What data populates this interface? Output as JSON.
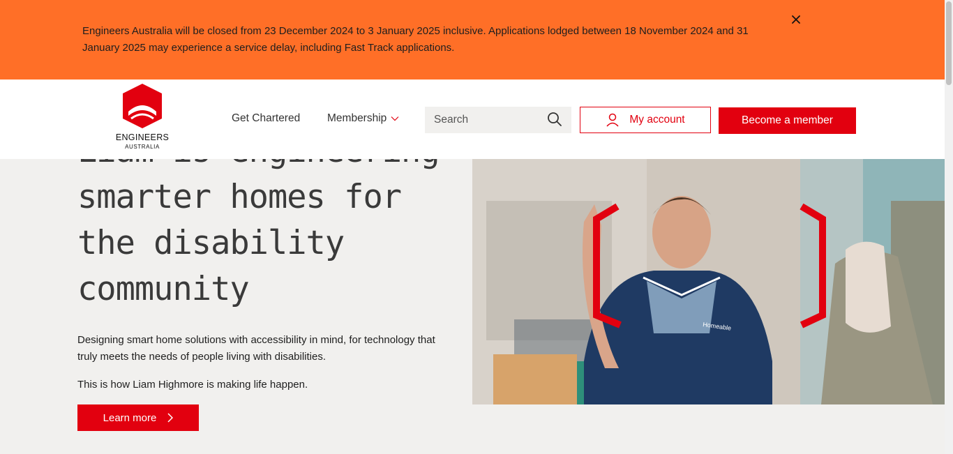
{
  "notice": {
    "text": "Engineers Australia will be closed from 23 December 2024 to 3 January 2025 inclusive. Applications lodged between 18 November 2024 and 31 January 2025 may experience a service delay, including Fast Track applications.",
    "bg_color": "#ff6f27"
  },
  "header": {
    "logo": {
      "line1": "ENGINEERS",
      "line2": "AUSTRALIA"
    },
    "nav": [
      {
        "label": "Get Chartered"
      },
      {
        "label": "Membership"
      }
    ],
    "search": {
      "placeholder": "Search",
      "value": ""
    },
    "account_label": "My account",
    "member_label": "Become a member",
    "brand_color": "#e2000f"
  },
  "hero": {
    "title": "Liam is engineering smarter homes for the disability community",
    "description": "Designing smart home solutions with accessibility in mind, for technology that truly meets the needs of people living with disabilities.",
    "subtext": "This is how Liam Highmore is making life happen.",
    "cta_label": "Learn more",
    "image": {
      "shirt_text": "Homeable"
    }
  }
}
